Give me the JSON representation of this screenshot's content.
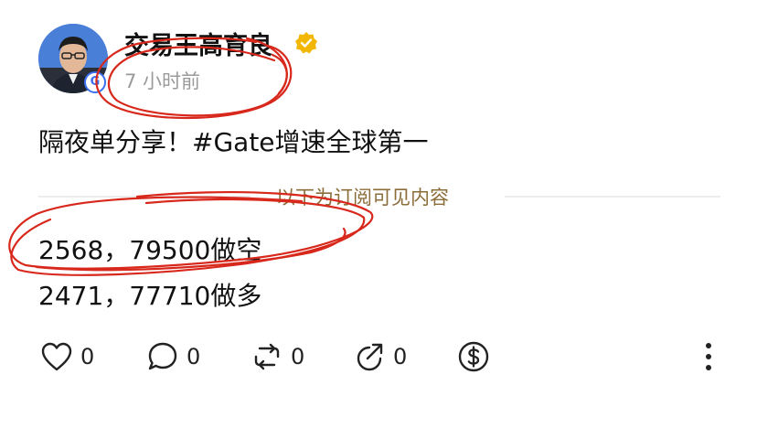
{
  "post": {
    "author": {
      "name": "交易王高育良",
      "avatar_badge": "G",
      "verified_icon": "verified-badge-icon",
      "verified_color": "#f2b705"
    },
    "time": "7 小时前",
    "text": "隔夜单分享！#Gate增速全球第一",
    "subscription_divider": "以下为订阅可见内容",
    "content_lines": [
      "2568，79500做空",
      "2471，77710做多"
    ]
  },
  "actions": {
    "like": {
      "icon": "heart-icon",
      "count": "0"
    },
    "comment": {
      "icon": "comment-icon",
      "count": "0"
    },
    "repost": {
      "icon": "repost-icon",
      "count": "0"
    },
    "share": {
      "icon": "share-icon",
      "count": "0"
    },
    "tip": {
      "icon": "dollar-icon"
    },
    "more": {
      "icon": "more-vertical-icon"
    }
  },
  "colors": {
    "annotation_red": "#d8281c",
    "divider_label": "#8b6d3a",
    "brand_blue": "#3b6ff0"
  }
}
